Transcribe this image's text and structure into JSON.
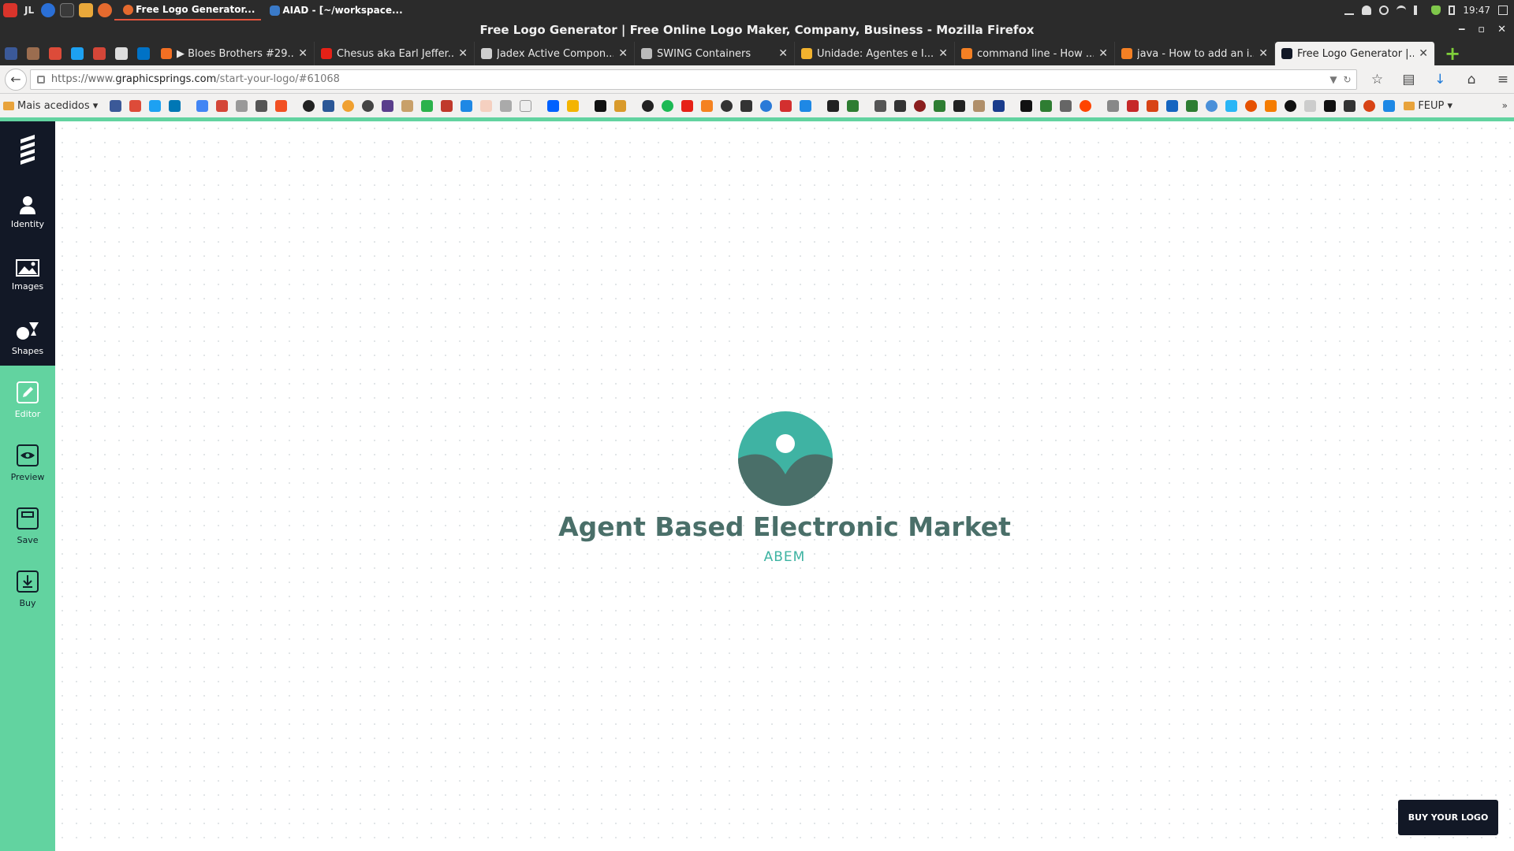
{
  "system": {
    "user": "JL",
    "tasks": [
      {
        "label": "Free Logo Generator..."
      },
      {
        "label": "AIAD - [~/workspace..."
      }
    ],
    "clock": "19:47"
  },
  "window": {
    "title": "Free Logo Generator | Free Online Logo Maker, Company, Business - Mozilla Firefox"
  },
  "tabs": [
    {
      "label": "▶ Bloes Brothers #29..."
    },
    {
      "label": "Chesus aka Earl Jeffer..."
    },
    {
      "label": "Jadex Active Compon..."
    },
    {
      "label": "SWING Containers"
    },
    {
      "label": "Unidade: Agentes e I..."
    },
    {
      "label": "command line - How ..."
    },
    {
      "label": "java - How to add an i..."
    },
    {
      "label": "Free Logo Generator |..."
    }
  ],
  "nav": {
    "url_prefix": "https://www.",
    "url_host": "graphicsprings.com",
    "url_path": "/start-your-logo/#61068"
  },
  "bookmarks": {
    "first_folder": "Mais acedidos",
    "last_folder": "FEUP"
  },
  "sidebar": {
    "items": [
      {
        "label": "Identity"
      },
      {
        "label": "Images"
      },
      {
        "label": "Shapes"
      },
      {
        "label": "Editor"
      },
      {
        "label": "Preview"
      },
      {
        "label": "Save"
      },
      {
        "label": "Buy"
      }
    ]
  },
  "logo": {
    "name": "Agent Based Electronic Market",
    "tagline": "ABEM",
    "colors": {
      "mark_top": "#3fb3a3",
      "mark_bottom": "#4a6f69",
      "name": "#4a6f69",
      "tagline": "#3db3a2"
    }
  },
  "buy_button": "BUY YOUR LOGO",
  "theme": {
    "accent": "#62d3a0",
    "dark": "#121826"
  }
}
